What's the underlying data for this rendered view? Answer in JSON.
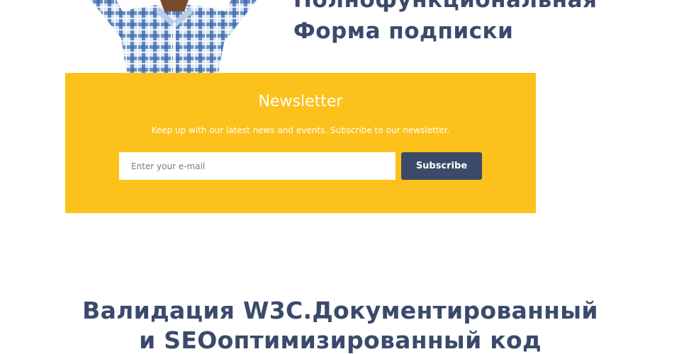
{
  "feature_heading": {
    "line1": "Полнофункциональная",
    "line2": "Форма подписки"
  },
  "newsletter": {
    "title": "Newsletter",
    "subtitle": "Keep up with our latest news and events. Subscribe to our newsletter.",
    "email_placeholder": "Enter your e-mail",
    "subscribe_label": "Subscribe"
  },
  "validation_heading": {
    "line1": "Валидация W3C.Документированный",
    "line2": "и SEOоптимизированный код"
  },
  "colors": {
    "newsletter_bg": "#fcc11a",
    "button_bg": "#3a4a68",
    "heading": "#3b4a6b"
  },
  "icons": {
    "person_photo": "person-arms-raised-plaid-shirt"
  }
}
